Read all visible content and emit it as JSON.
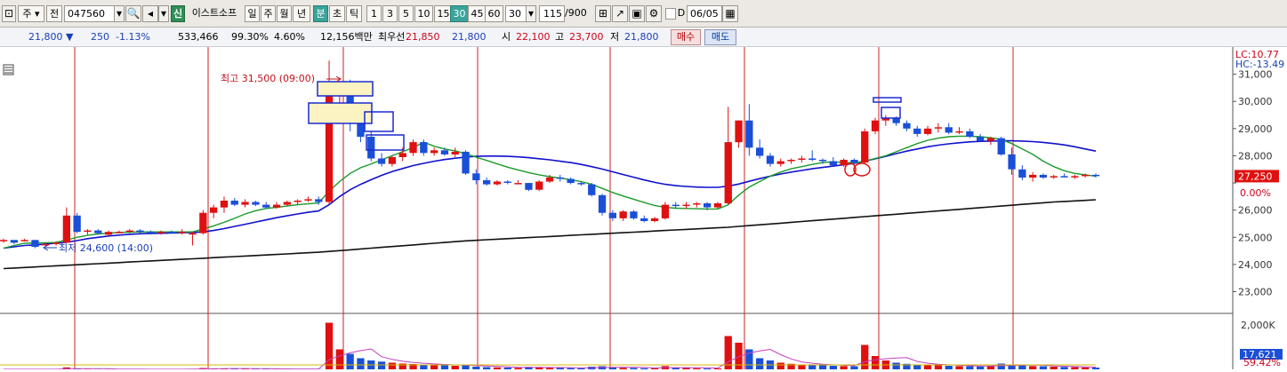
{
  "toolbar": {
    "market": "주",
    "prev_label": "전",
    "code": "047560",
    "credit_badge": "신",
    "stock_name": "이스트소프",
    "periods": [
      "일",
      "주",
      "월",
      "년"
    ],
    "minute_label": "분",
    "second_label": "초",
    "tick_label": "틱",
    "intervals": [
      "1",
      "3",
      "5",
      "10",
      "15",
      "30",
      "45",
      "60"
    ],
    "selected_interval": "30",
    "interval_select": "30",
    "count": "115",
    "count_max": "/900",
    "date_checkbox_label": "D",
    "date": "06/05"
  },
  "quote": {
    "price": "21,800",
    "change": "250",
    "change_rate": "-1.13%",
    "volume": "533,466",
    "volume_ratio": "99.30%",
    "turnover": "4.60%",
    "amount": "12,156백만",
    "best_label": "최우선",
    "best_ask": "21,850",
    "best_bid": "21,800",
    "open_label": "시",
    "open": "22,100",
    "high_label": "고",
    "high": "23,700",
    "low_label": "저",
    "low": "21,800",
    "buy_button": "매수",
    "sell_button": "매도"
  },
  "chart_data": {
    "type": "candlestick",
    "price_axis": {
      "ticks": [
        31000,
        30000,
        29000,
        28000,
        27000,
        26000,
        25000,
        24000,
        23000
      ],
      "tick_labels": [
        "31,000",
        "30,000",
        "29,000",
        "28,000",
        "",
        "26,000",
        "25,000",
        "24,000",
        "23,000"
      ],
      "ylim": [
        22200,
        32000
      ]
    },
    "lc_label": "LC:10.77",
    "hc_label": "HC:-13.49",
    "current_price_label": "27,250",
    "current_pct_label": "0.00%",
    "high_annotation": "최고 31,500 (09:00)",
    "low_annotation": "최저 24,600 (14:00)",
    "volume_axis": {
      "tick_labels": [
        "2,000K"
      ]
    },
    "volume_current_label": "17,621",
    "volume_pct_label": "59.42%",
    "day_separators_x": [
      84,
      234,
      386,
      537,
      686,
      837,
      988,
      1139
    ],
    "colors": {
      "up": "#e01010",
      "down": "#1a4fd8",
      "ma_short": "#1a9a2a",
      "ma_mid": "#1010cc",
      "ma_long": "#111111",
      "separator": "#cc2222"
    },
    "candles": [
      [
        24850,
        24950,
        24800,
        24900
      ],
      [
        24900,
        24900,
        24750,
        24800
      ],
      [
        24850,
        24950,
        24850,
        24900
      ],
      [
        24900,
        24900,
        24600,
        24650
      ],
      [
        24700,
        24800,
        24650,
        24750
      ],
      [
        24750,
        24850,
        24700,
        24800
      ],
      [
        24800,
        26100,
        24800,
        25800
      ],
      [
        25800,
        25900,
        25150,
        25200
      ],
      [
        25200,
        25300,
        25100,
        25250
      ],
      [
        25250,
        25300,
        25100,
        25150
      ],
      [
        25100,
        25250,
        25050,
        25200
      ],
      [
        25200,
        25250,
        25150,
        25200
      ],
      [
        25200,
        25300,
        25150,
        25250
      ],
      [
        25250,
        25300,
        25150,
        25200
      ],
      [
        25200,
        25250,
        25100,
        25150
      ],
      [
        25150,
        25250,
        25100,
        25200
      ],
      [
        25200,
        25250,
        25150,
        25150
      ],
      [
        25150,
        25300,
        25100,
        25200
      ],
      [
        25100,
        25200,
        24700,
        25150
      ],
      [
        25150,
        26000,
        25100,
        25900
      ],
      [
        25900,
        26200,
        25700,
        26100
      ],
      [
        26100,
        26500,
        25900,
        26350
      ],
      [
        26350,
        26450,
        26150,
        26200
      ],
      [
        26200,
        26400,
        26100,
        26300
      ],
      [
        26300,
        26350,
        26150,
        26200
      ],
      [
        26200,
        26300,
        26050,
        26100
      ],
      [
        26100,
        26300,
        26050,
        26200
      ],
      [
        26200,
        26350,
        26150,
        26300
      ],
      [
        26300,
        26400,
        26200,
        26350
      ],
      [
        26350,
        26500,
        26300,
        26400
      ],
      [
        26400,
        26500,
        26200,
        26300
      ],
      [
        26300,
        31500,
        26200,
        30200
      ],
      [
        30200,
        30700,
        29300,
        30300
      ],
      [
        30300,
        30800,
        28900,
        29300
      ],
      [
        29300,
        29500,
        28500,
        28700
      ],
      [
        28700,
        28900,
        27800,
        27900
      ],
      [
        27900,
        28100,
        27600,
        27700
      ],
      [
        27700,
        28000,
        27600,
        27950
      ],
      [
        27950,
        28300,
        27800,
        28100
      ],
      [
        28100,
        28600,
        28000,
        28500
      ],
      [
        28500,
        28600,
        28000,
        28100
      ],
      [
        28100,
        28300,
        28000,
        28200
      ],
      [
        28200,
        28300,
        28000,
        28050
      ],
      [
        28050,
        28300,
        27950,
        28150
      ],
      [
        28150,
        28200,
        27300,
        27350
      ],
      [
        27350,
        27500,
        26950,
        27100
      ],
      [
        27100,
        27200,
        26900,
        26950
      ],
      [
        26950,
        27100,
        26900,
        27050
      ],
      [
        27050,
        27100,
        26950,
        27000
      ],
      [
        27000,
        27100,
        26950,
        27000
      ],
      [
        27000,
        27000,
        26700,
        26750
      ],
      [
        26750,
        27100,
        26700,
        27050
      ],
      [
        27050,
        27300,
        27000,
        27200
      ],
      [
        27200,
        27300,
        27050,
        27150
      ],
      [
        27150,
        27200,
        26950,
        27000
      ],
      [
        27000,
        27050,
        26900,
        26950
      ],
      [
        26950,
        27000,
        26500,
        26550
      ],
      [
        26550,
        26600,
        25800,
        25900
      ],
      [
        25900,
        26000,
        25600,
        25700
      ],
      [
        25700,
        26000,
        25600,
        25950
      ],
      [
        25950,
        26000,
        25650,
        25700
      ],
      [
        25700,
        25800,
        25550,
        25600
      ],
      [
        25600,
        25750,
        25550,
        25700
      ],
      [
        25700,
        26300,
        25650,
        26200
      ],
      [
        26200,
        26300,
        26050,
        26150
      ],
      [
        26150,
        26300,
        26050,
        26200
      ],
      [
        26200,
        26300,
        26100,
        26250
      ],
      [
        26250,
        26300,
        26000,
        26100
      ],
      [
        26100,
        26300,
        26050,
        26250
      ],
      [
        26250,
        29800,
        26200,
        28500
      ],
      [
        28500,
        29300,
        28300,
        29300
      ],
      [
        29300,
        29900,
        28000,
        28300
      ],
      [
        28300,
        28600,
        27900,
        28000
      ],
      [
        28000,
        28100,
        27600,
        27700
      ],
      [
        27700,
        27900,
        27600,
        27800
      ],
      [
        27800,
        27900,
        27700,
        27850
      ],
      [
        27850,
        28000,
        27750,
        27900
      ],
      [
        27900,
        28200,
        27800,
        27850
      ],
      [
        27850,
        27900,
        27700,
        27800
      ],
      [
        27800,
        27950,
        27600,
        27650
      ],
      [
        27650,
        27900,
        27600,
        27850
      ],
      [
        27850,
        27900,
        27700,
        27750
      ],
      [
        27750,
        29000,
        27700,
        28900
      ],
      [
        28900,
        29400,
        28800,
        29300
      ],
      [
        29300,
        29500,
        29100,
        29400
      ],
      [
        29400,
        29450,
        29100,
        29200
      ],
      [
        29200,
        29300,
        28900,
        29000
      ],
      [
        29000,
        29100,
        28700,
        28800
      ],
      [
        28800,
        29100,
        28750,
        29000
      ],
      [
        29000,
        29200,
        28850,
        29050
      ],
      [
        29050,
        29200,
        28800,
        28850
      ],
      [
        28850,
        29050,
        28800,
        28900
      ],
      [
        28900,
        29000,
        28650,
        28700
      ],
      [
        28700,
        28800,
        28500,
        28550
      ],
      [
        28550,
        28700,
        28400,
        28650
      ],
      [
        28650,
        28700,
        28000,
        28050
      ],
      [
        28050,
        28300,
        27300,
        27500
      ],
      [
        27500,
        27650,
        27100,
        27200
      ],
      [
        27200,
        27400,
        27050,
        27300
      ],
      [
        27300,
        27350,
        27150,
        27200
      ],
      [
        27200,
        27300,
        27150,
        27250
      ],
      [
        27250,
        27350,
        27200,
        27200
      ],
      [
        27200,
        27300,
        27150,
        27250
      ],
      [
        27250,
        27350,
        27200,
        27300
      ],
      [
        27300,
        27350,
        27200,
        27250
      ]
    ],
    "ma_short": [
      24600,
      24700,
      24780,
      24790,
      24800,
      24810,
      24900,
      25000,
      25070,
      25120,
      25150,
      25180,
      25190,
      25200,
      25200,
      25200,
      25200,
      25200,
      25200,
      25300,
      25420,
      25550,
      25700,
      25860,
      25980,
      26060,
      26100,
      26150,
      26200,
      26230,
      26260,
      26700,
      27050,
      27350,
      27560,
      27700,
      27850,
      28000,
      28150,
      28300,
      28500,
      28350,
      28250,
      28180,
      28080,
      27950,
      27830,
      27700,
      27580,
      27480,
      27380,
      27300,
      27230,
      27180,
      27120,
      27050,
      26950,
      26800,
      26650,
      26520,
      26400,
      26280,
      26170,
      26100,
      26070,
      26060,
      26050,
      26040,
      26040,
      26200,
      26550,
      26850,
      27050,
      27250,
      27400,
      27520,
      27600,
      27680,
      27750,
      27780,
      27750,
      27740,
      27800,
      27900,
      28000,
      28150,
      28300,
      28450,
      28570,
      28650,
      28700,
      28720,
      28720,
      28700,
      28660,
      28600,
      28450,
      28250,
      28050,
      27800,
      27600,
      27450,
      27350,
      27300,
      27250
    ],
    "ma_mid": [
      24600,
      24650,
      24700,
      24720,
      24750,
      24780,
      24820,
      24880,
      24950,
      25000,
      25050,
      25080,
      25110,
      25130,
      25140,
      25150,
      25160,
      25170,
      25180,
      25200,
      25250,
      25320,
      25400,
      25480,
      25560,
      25640,
      25720,
      25790,
      25860,
      25920,
      25970,
      26200,
      26500,
      26750,
      26950,
      27120,
      27280,
      27420,
      27530,
      27640,
      27720,
      27800,
      27860,
      27910,
      27950,
      27980,
      27990,
      27990,
      27980,
      27960,
      27930,
      27890,
      27850,
      27800,
      27750,
      27680,
      27600,
      27510,
      27410,
      27310,
      27210,
      27110,
      27020,
      26950,
      26900,
      26870,
      26850,
      26840,
      26840,
      26880,
      26960,
      27060,
      27160,
      27250,
      27330,
      27400,
      27460,
      27520,
      27570,
      27620,
      27670,
      27720,
      27800,
      27890,
      27980,
      28080,
      28170,
      28250,
      28330,
      28390,
      28440,
      28480,
      28510,
      28530,
      28540,
      28550,
      28550,
      28540,
      28520,
      28490,
      28450,
      28400,
      28330,
      28250,
      28170
    ],
    "ma_long": [
      23850,
      23870,
      23890,
      23910,
      23930,
      23950,
      23970,
      23990,
      24010,
      24030,
      24050,
      24070,
      24090,
      24110,
      24130,
      24150,
      24170,
      24190,
      24210,
      24230,
      24250,
      24270,
      24290,
      24310,
      24330,
      24350,
      24370,
      24390,
      24410,
      24430,
      24450,
      24480,
      24510,
      24540,
      24570,
      24600,
      24630,
      24660,
      24690,
      24720,
      24750,
      24780,
      24810,
      24840,
      24870,
      24890,
      24910,
      24930,
      24950,
      24970,
      24990,
      25010,
      25030,
      25050,
      25070,
      25090,
      25110,
      25130,
      25150,
      25170,
      25190,
      25210,
      25230,
      25250,
      25270,
      25290,
      25310,
      25330,
      25350,
      25370,
      25400,
      25430,
      25460,
      25490,
      25520,
      25550,
      25580,
      25610,
      25640,
      25670,
      25700,
      25730,
      25760,
      25790,
      25820,
      25850,
      25880,
      25910,
      25940,
      25970,
      26000,
      26030,
      26060,
      26090,
      26120,
      26150,
      26180,
      26210,
      26240,
      26270,
      26300,
      26320,
      26340,
      26360,
      26380
    ],
    "volume_max": 2000,
    "volumes": [
      5,
      4,
      6,
      8,
      5,
      4,
      90,
      30,
      12,
      10,
      8,
      6,
      5,
      6,
      5,
      6,
      5,
      4,
      15,
      60,
      40,
      35,
      30,
      25,
      22,
      20,
      18,
      16,
      14,
      12,
      12,
      2100,
      900,
      700,
      500,
      400,
      350,
      300,
      260,
      240,
      220,
      200,
      180,
      160,
      200,
      120,
      100,
      90,
      80,
      70,
      110,
      90,
      70,
      60,
      55,
      50,
      120,
      140,
      90,
      70,
      60,
      50,
      50,
      150,
      80,
      60,
      50,
      40,
      40,
      1500,
      1200,
      900,
      500,
      400,
      300,
      250,
      220,
      200,
      180,
      160,
      150,
      140,
      1100,
      600,
      400,
      300,
      250,
      220,
      200,
      180,
      160,
      150,
      140,
      130,
      160,
      260,
      200,
      180,
      150,
      140,
      120,
      110,
      100,
      90,
      80
    ],
    "markers": {
      "high_boxes": [
        [
          357,
          39,
          62,
          16
        ],
        [
          347,
          63,
          71,
          23
        ],
        [
          410,
          73,
          32,
          22
        ],
        [
          412,
          99,
          42,
          17
        ]
      ],
      "top_boxes": [
        [
          982,
          57,
          31,
          5
        ],
        [
          991,
          68,
          21,
          12
        ]
      ],
      "circle": [
        962,
        138
      ]
    }
  }
}
